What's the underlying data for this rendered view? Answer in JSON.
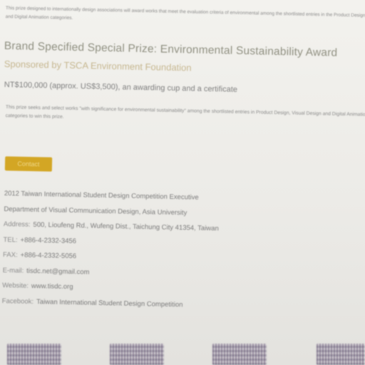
{
  "intro_text": "This prize designed to internationally design associations will award works that meet the evaluation criteria of environmental among the shortlisted entries in the Product Design, Visual Design, and Digital Animation categories.",
  "prize": {
    "title": "Brand Specified Special Prize: Environmental Sustainability Award",
    "sponsor": "Sponsored by TSCA Environment Foundation",
    "award": "NT$100,000 (approx. US$3,500), an awarding cup and a certificate",
    "criteria": "This prize seeks and select works \"with significance for environmental sustainability\" among the shortlisted entries in Product Design, Visual Design and Digital Animation categories to win this prize."
  },
  "contact_badge": "Contact",
  "contact": {
    "org": "2012 Taiwan International Student Design Competition Executive",
    "dept": "Department of Visual Communication Design, Asia University",
    "address_label": "Address:",
    "address": "500, Lioufeng Rd., Wufeng Dist., Taichung City 41354, Taiwan",
    "tel_label": "TEL:",
    "tel": "+886-4-2332-3456",
    "fax_label": "FAX:",
    "fax": "+886-4-2332-5056",
    "email_label": "E-mail:",
    "email": "tisdc.net@gmail.com",
    "website_label": "Website:",
    "website": "www.tisdc.org",
    "facebook_label": "Facebook:",
    "facebook": "Taiwan International Student Design Competition"
  },
  "logos": [
    "logo-1",
    "logo-2",
    "logo-3",
    "logo-4"
  ]
}
